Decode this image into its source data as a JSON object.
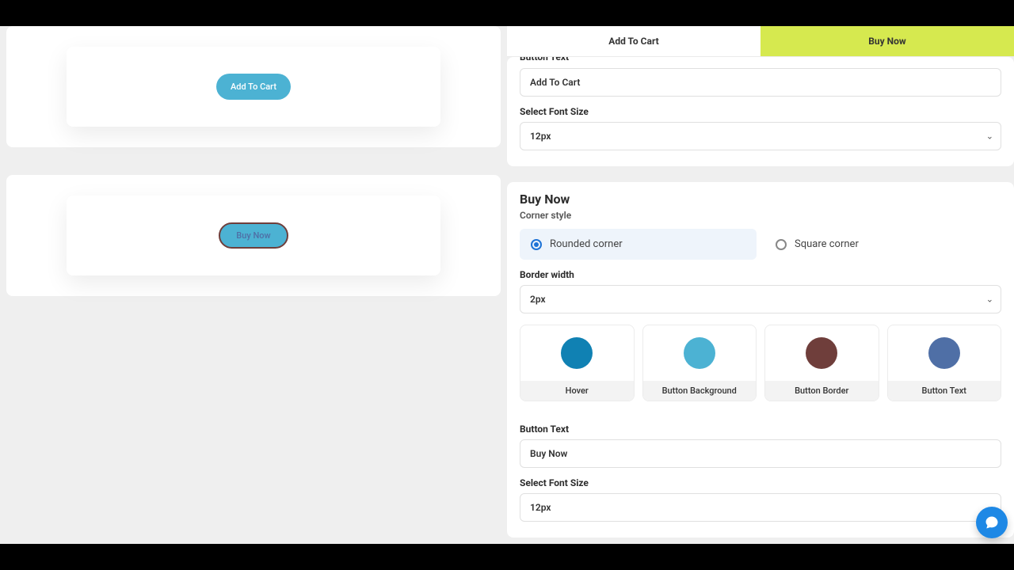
{
  "tabs": {
    "add_to_cart": "Add To Cart",
    "buy_now": "Buy Now"
  },
  "preview": {
    "add_to_cart_label": "Add To Cart",
    "buy_now_label": "Buy Now"
  },
  "atc": {
    "button_text_label": "Button Text",
    "button_text_value": "Add To Cart",
    "font_size_label": "Select Font Size",
    "font_size_value": "12px"
  },
  "bn": {
    "section_title": "Buy Now",
    "corner_style_label": "Corner style",
    "corner_rounded": "Rounded corner",
    "corner_square": "Square corner",
    "border_width_label": "Border width",
    "border_width_value": "2px",
    "swatches": [
      {
        "label": "Hover",
        "color": "#1081b3"
      },
      {
        "label": "Button Background",
        "color": "#4cb2d3"
      },
      {
        "label": "Button Border",
        "color": "#6f3e3b"
      },
      {
        "label": "Button Text",
        "color": "#4f6fa6"
      }
    ],
    "button_text_label": "Button Text",
    "button_text_value": "Buy Now",
    "font_size_label": "Select Font Size",
    "font_size_value": "12px"
  }
}
